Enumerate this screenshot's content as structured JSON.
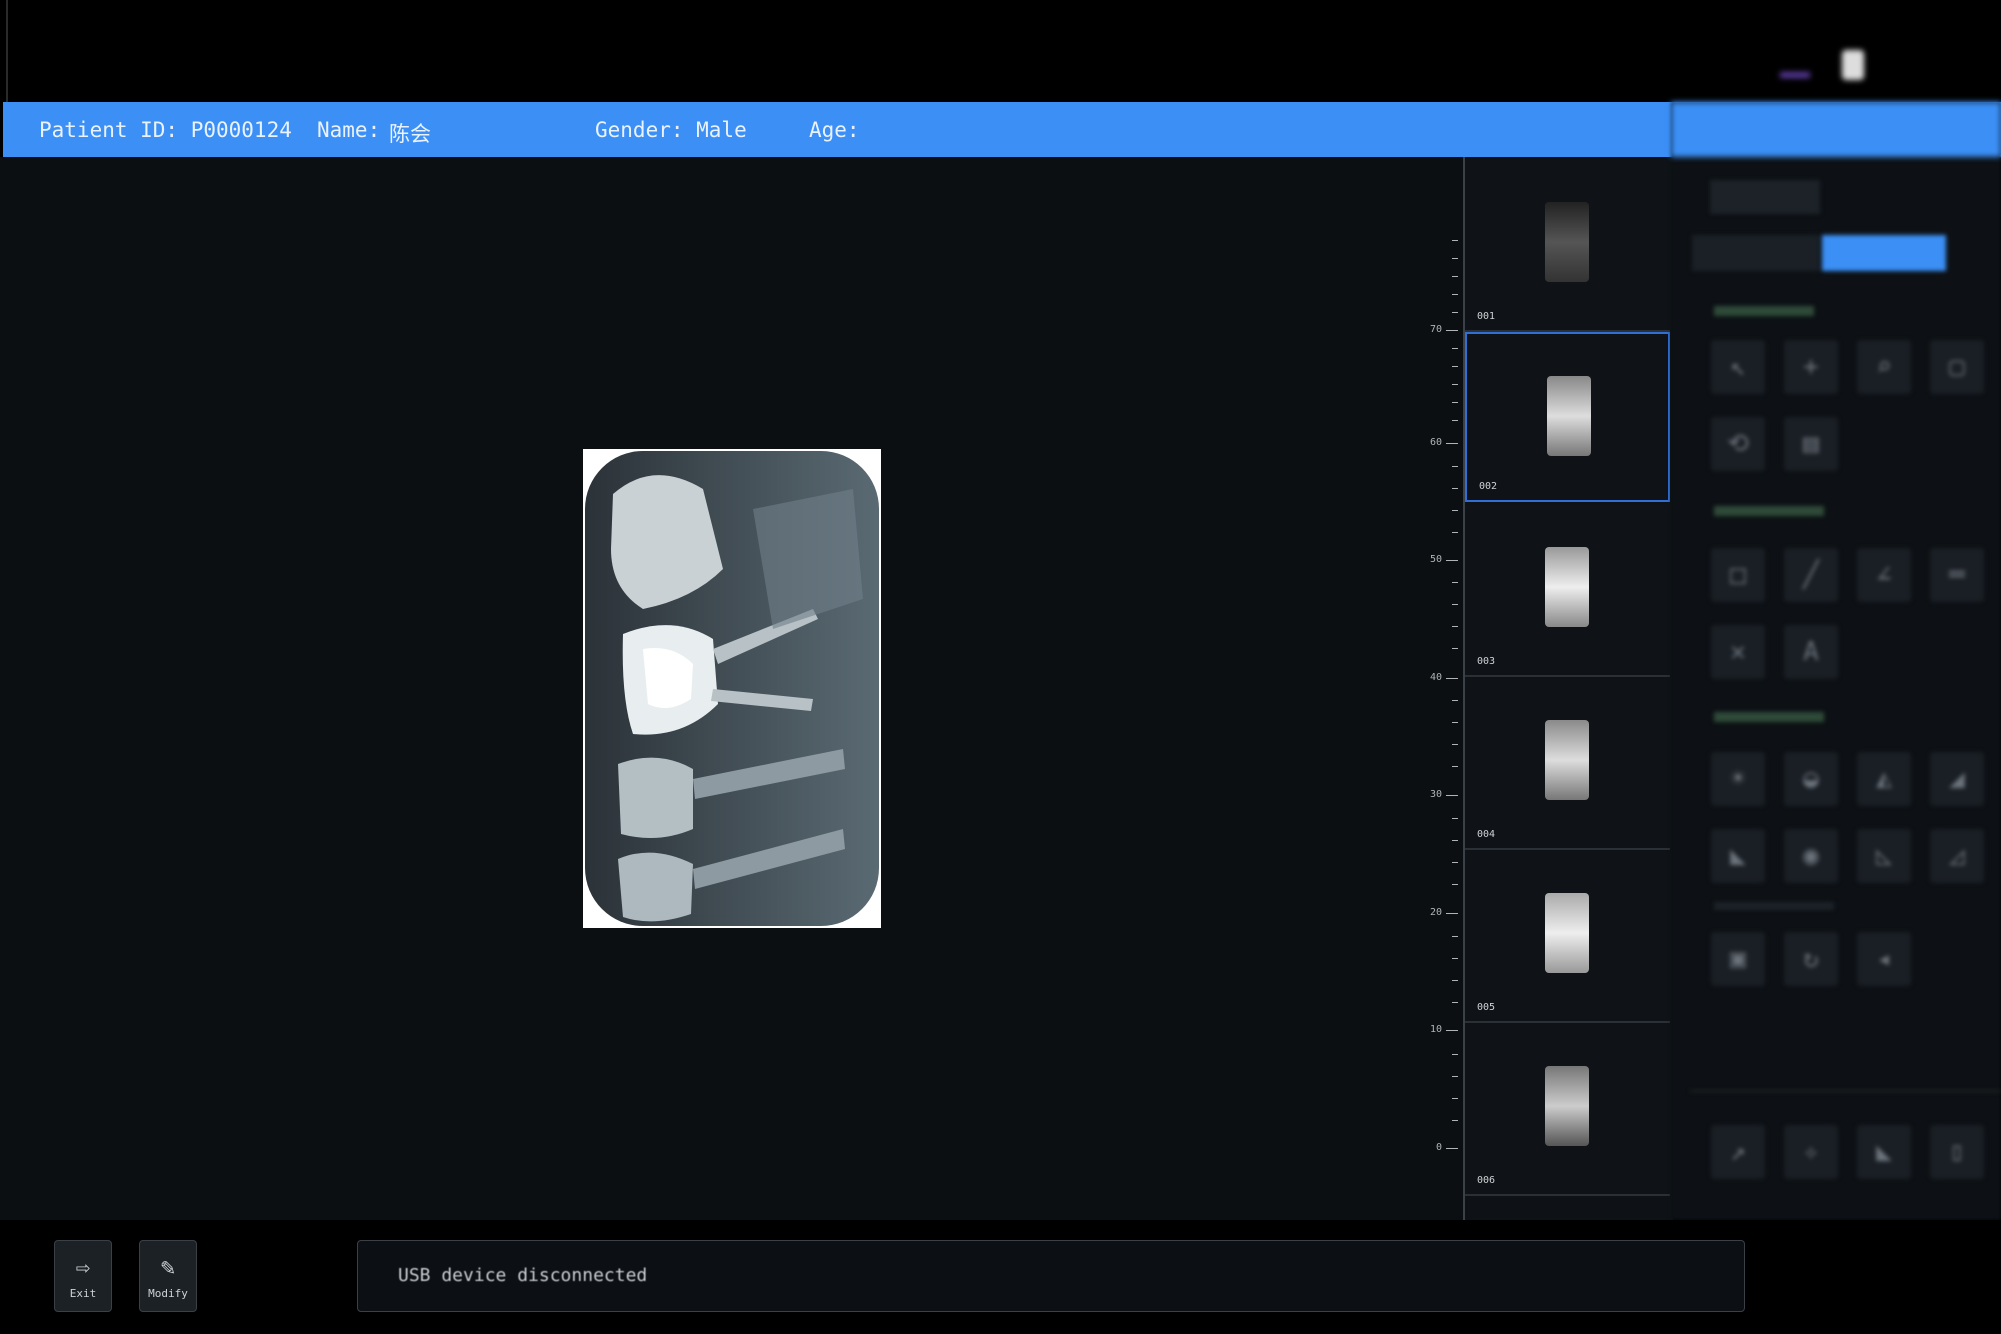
{
  "patient_bar": {
    "id": "Patient ID: P0000124",
    "name_label": "Name:",
    "name_value": "陈会",
    "gender": "Gender: Male",
    "age": "Age:"
  },
  "thumbnails": [
    {
      "num": "001"
    },
    {
      "num": "002",
      "selected": true
    },
    {
      "num": "003"
    },
    {
      "num": "004"
    },
    {
      "num": "005"
    },
    {
      "num": "006"
    }
  ],
  "bottom": {
    "exit_label": "Exit",
    "modify_label": "Modify",
    "status": "USB device disconnected"
  },
  "colors": {
    "accent": "#3b8ff5",
    "selected_border": "#2f6fd6"
  },
  "icons": {
    "exit": "exit-icon",
    "modify": "edit-icon"
  }
}
